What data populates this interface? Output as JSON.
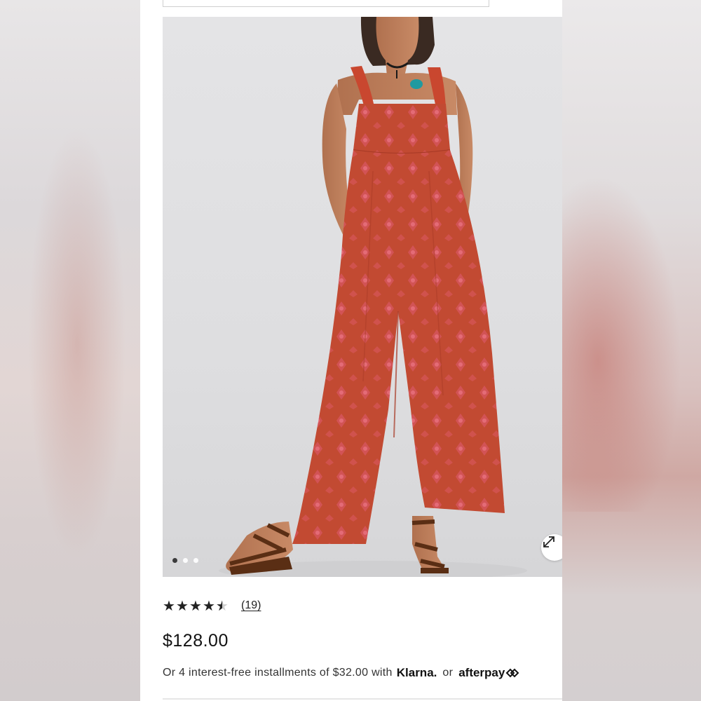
{
  "product": {
    "image_alt": "Red printed wide-leg jumpsuit with ruffle straps",
    "carousel": {
      "count": 3,
      "active_index": 0
    },
    "rating": {
      "value": 4.5,
      "max": 5,
      "review_count_label": "(19)"
    },
    "price": "$128.00",
    "installments": {
      "text": "Or 4 interest-free installments of $32.00 with",
      "klarna_label": "Klarna.",
      "or_label": "or",
      "afterpay_label": "afterpay"
    }
  },
  "colors": {
    "garment": "#c24a32",
    "pattern": "#e8587a",
    "background": "#e2e2e4"
  },
  "icons": {
    "expand": "expand-arrows-icon",
    "afterpay": "afterpay-loop-icon"
  }
}
